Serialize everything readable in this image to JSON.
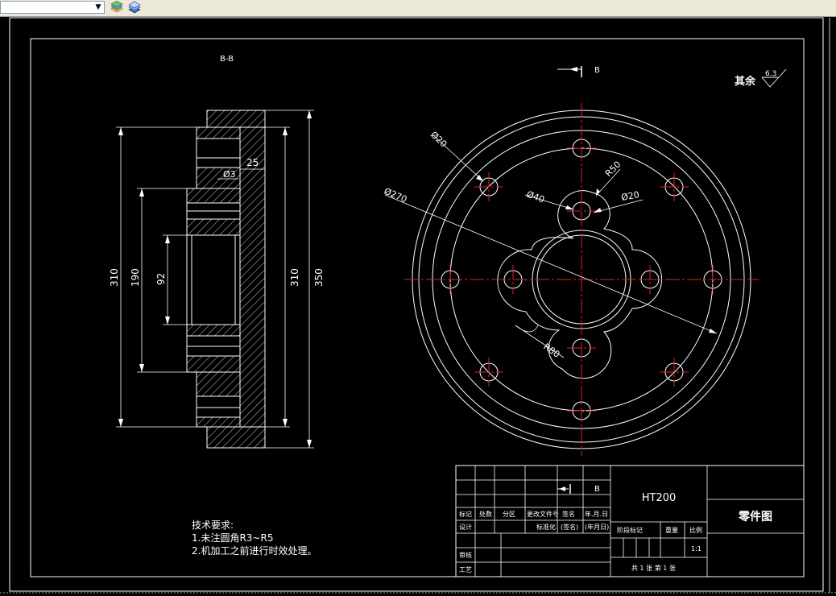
{
  "toolbar": {
    "layer_dropdown_value": "",
    "icons": [
      "layer-states-icon",
      "layer-stack-icon"
    ]
  },
  "section_view": {
    "title": "B-B",
    "dims": [
      "310",
      "190",
      "92",
      "310",
      "350",
      "25",
      "Ø3"
    ]
  },
  "front_view": {
    "section_marker": "B",
    "surface_finish_label": "其余",
    "roughness_value": "6.3",
    "dims": [
      "Ø20",
      "Ø270",
      "Ø40",
      "R50",
      "Ø20",
      "R80"
    ]
  },
  "notes": {
    "heading": "技术要求:",
    "line1": "1.未注圆角R3~R5",
    "line2": "2.机加工之前进行时效处理。"
  },
  "title_block": {
    "material": "HT200",
    "drawing_name": "零件图",
    "section_marker": "B",
    "header_row": [
      "标记",
      "处数",
      "分区",
      "更改文件号",
      "签名",
      "年.月.日"
    ],
    "row_design": [
      "设计",
      "标准化",
      "(签名)",
      "(年月日)"
    ],
    "stage_label": "阶段标记",
    "weight_label": "重量",
    "scale_label": "比例",
    "scale_value": "1:1",
    "check_label": "审核",
    "process_label": "工艺",
    "sheet_info": "共 1 张 第 1 张"
  }
}
